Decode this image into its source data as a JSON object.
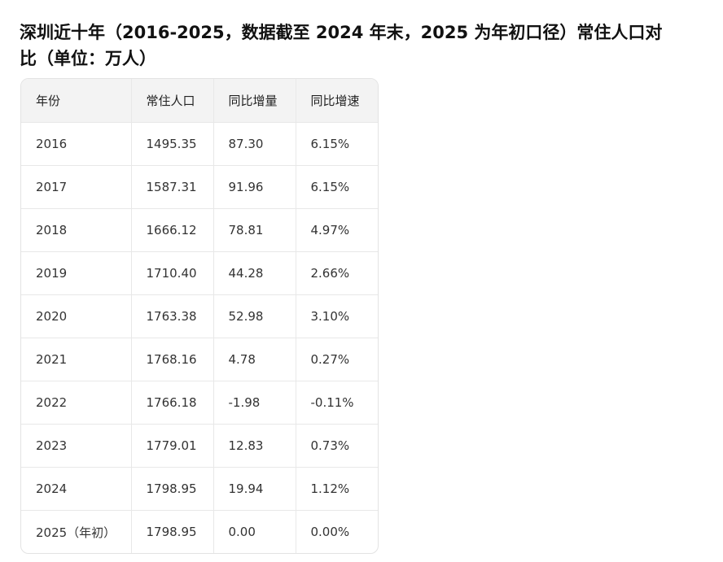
{
  "title": "深圳近十年（2016-2025，数据截至 2024 年末，2025 为年初口径）常住人口对比（单位：万人）",
  "table": {
    "headers": [
      "年份",
      "常住人口",
      "同比增量",
      "同比增速"
    ],
    "rows": [
      [
        "2016",
        "1495.35",
        "87.30",
        "6.15%"
      ],
      [
        "2017",
        "1587.31",
        "91.96",
        "6.15%"
      ],
      [
        "2018",
        "1666.12",
        "78.81",
        "4.97%"
      ],
      [
        "2019",
        "1710.40",
        "44.28",
        "2.66%"
      ],
      [
        "2020",
        "1763.38",
        "52.98",
        "3.10%"
      ],
      [
        "2021",
        "1768.16",
        "4.78",
        "0.27%"
      ],
      [
        "2022",
        "1766.18",
        "-1.98",
        "-0.11%"
      ],
      [
        "2023",
        "1779.01",
        "12.83",
        "0.73%"
      ],
      [
        "2024",
        "1798.95",
        "19.94",
        "1.12%"
      ],
      [
        "2025（年初）",
        "1798.95",
        "0.00",
        "0.00%"
      ]
    ]
  }
}
